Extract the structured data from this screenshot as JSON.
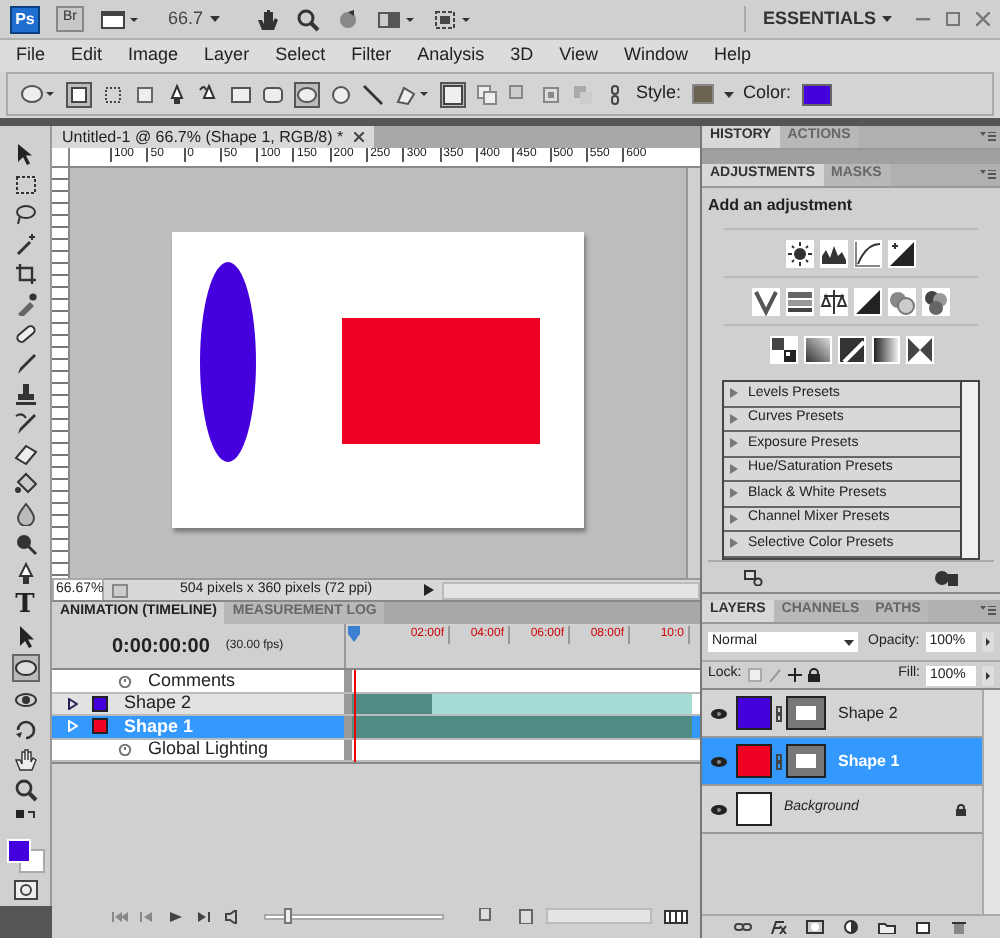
{
  "app_bar": {
    "logo": "Ps",
    "bridge": "Br",
    "zoom": "66.7",
    "workspace": "ESSENTIALS"
  },
  "menu": [
    "File",
    "Edit",
    "Image",
    "Layer",
    "Select",
    "Filter",
    "Analysis",
    "3D",
    "View",
    "Window",
    "Help"
  ],
  "options_bar": {
    "style_label": "Style:",
    "color_label": "Color:"
  },
  "toolbox": {
    "text_tool": "T"
  },
  "document": {
    "tab": "Untitled-1 @ 66.7% (Shape 1, RGB/8) *",
    "ruler": [
      "100",
      "50",
      "0",
      "50",
      "100",
      "150",
      "200",
      "250",
      "300",
      "350",
      "400",
      "450",
      "500",
      "550",
      "600"
    ]
  },
  "status_bar": {
    "zoom": "66.67%",
    "info": "504 pixels x 360 pixels (72 ppi)"
  },
  "animation": {
    "tabs": [
      {
        "label": "ANIMATION (TIMELINE)",
        "selected": true
      },
      {
        "label": "MEASUREMENT LOG",
        "selected": false
      }
    ],
    "zoom_slider": {
      "level": 0.1
    },
    "time": "0:00:00:00",
    "fps": "(30.00 fps)",
    "ticks": [
      "02:00f",
      "04:00f",
      "06:00f",
      "08:00f",
      "10:0"
    ],
    "tracks": [
      {
        "label": "Comments",
        "kind": "property",
        "selected": false
      },
      {
        "label": "Shape 2",
        "kind": "layer",
        "selected": false,
        "color": "#4400dd"
      },
      {
        "label": "Shape 1",
        "kind": "layer",
        "selected": true,
        "color": "#ee0022"
      },
      {
        "label": "Global Lighting",
        "kind": "property",
        "selected": false
      }
    ]
  },
  "history_panel": {
    "tabs": [
      {
        "label": "HISTORY",
        "selected": true
      },
      {
        "label": "ACTIONS",
        "selected": false
      }
    ]
  },
  "adjustments_panel": {
    "tabs": [
      {
        "label": "ADJUSTMENTS",
        "selected": true
      },
      {
        "label": "MASKS",
        "selected": false
      }
    ],
    "heading": "Add an adjustment",
    "presets": [
      "Levels Presets",
      "Curves Presets",
      "Exposure Presets",
      "Hue/Saturation Presets",
      "Black & White Presets",
      "Channel Mixer Presets",
      "Selective Color Presets"
    ]
  },
  "layers_panel": {
    "tabs": [
      {
        "label": "LAYERS",
        "selected": true
      },
      {
        "label": "CHANNELS",
        "selected": false
      },
      {
        "label": "PATHS",
        "selected": false
      }
    ],
    "blend_mode": "Normal",
    "opacity_label": "Opacity:",
    "opacity": "100%",
    "lock_label": "Lock:",
    "fill_label": "Fill:",
    "fill": "100%",
    "layers": [
      {
        "name": "Shape 2",
        "kind": "shape",
        "selected": false,
        "color": "#4400dd"
      },
      {
        "name": "Shape 1",
        "kind": "shape",
        "selected": true,
        "color": "#ee0022"
      },
      {
        "name": "Background",
        "kind": "background",
        "selected": false,
        "color": "#ffffff"
      }
    ]
  }
}
